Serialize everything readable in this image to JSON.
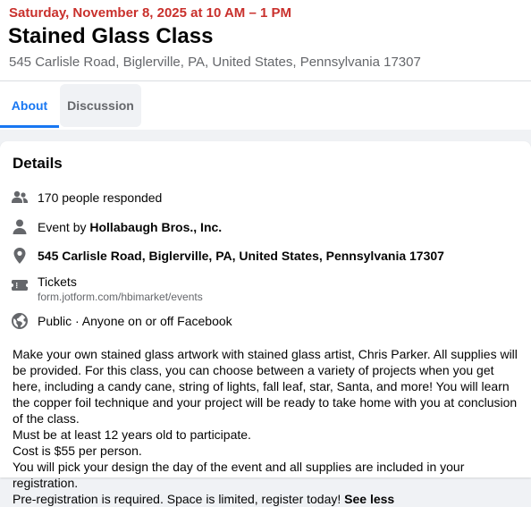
{
  "event": {
    "date_time": "Saturday, November 8, 2025 at 10 AM – 1 PM",
    "title": "Stained Glass Class",
    "location_subtitle": "545 Carlisle Road, Biglerville, PA, United States, Pennsylvania 17307"
  },
  "tabs": [
    {
      "label": "About",
      "active": true
    },
    {
      "label": "Discussion",
      "active": false
    }
  ],
  "details": {
    "heading": "Details",
    "responded": "170 people responded",
    "organizer_prefix": "Event by ",
    "organizer_name": "Hollabaugh Bros., Inc.",
    "address": "545 Carlisle Road, Biglerville, PA, United States, Pennsylvania 17307",
    "tickets_label": "Tickets",
    "tickets_url": "form.jotform.com/hbimarket/events",
    "privacy": "Public · Anyone on or off Facebook"
  },
  "description": {
    "line1": "Make your own stained glass artwork with stained glass artist, Chris Parker. All supplies will be provided. For this class, you can choose between a variety of projects when you get here, including a candy cane, string of lights, fall leaf, star, Santa, and more! You will learn the copper foil technique and your project will be ready to take home with you at conclusion of the class.",
    "line2": "Must be at least 12 years old to participate.",
    "line3": "Cost is $55 per person.",
    "line4": "You will pick your design the day of the event and all supplies are included in your registration.",
    "line5": "Pre-registration is required. Space is limited, register today! ",
    "see_less": "See less"
  },
  "icons": {
    "people": "people-icon",
    "person": "person-icon",
    "location": "location-pin-icon",
    "ticket": "ticket-icon",
    "globe": "globe-icon"
  },
  "colors": {
    "date": "#c9302c",
    "accent": "#1877f2",
    "secondary_text": "#65676b"
  }
}
